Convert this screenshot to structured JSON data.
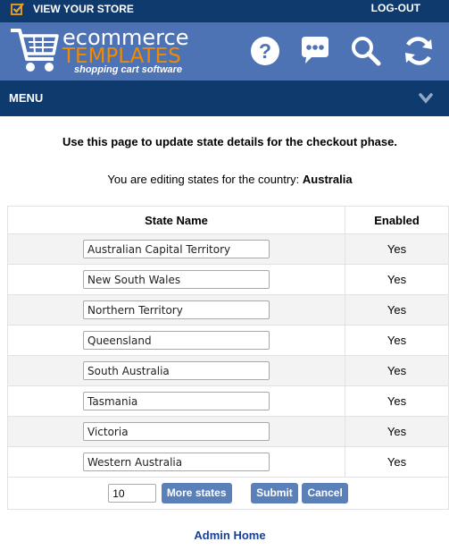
{
  "topbar": {
    "view_store": "VIEW YOUR STORE",
    "logout": "LOG-OUT"
  },
  "logo": {
    "line1": "ecommerce",
    "line2": "TEMPLATES",
    "tagline": "shopping cart software"
  },
  "header_icons": [
    "help-icon",
    "chat-icon",
    "search-icon",
    "refresh-icon"
  ],
  "menu": {
    "label": "MENU"
  },
  "intro": "Use this page to update state details for the checkout phase.",
  "country_prefix": "You are editing states for the country: ",
  "country": "Australia",
  "table": {
    "headers": [
      "State Name",
      "Enabled"
    ],
    "rows": [
      {
        "state": "Australian Capital Territory",
        "enabled": "Yes"
      },
      {
        "state": "New South Wales",
        "enabled": "Yes"
      },
      {
        "state": "Northern Territory",
        "enabled": "Yes"
      },
      {
        "state": "Queensland",
        "enabled": "Yes"
      },
      {
        "state": "South Australia",
        "enabled": "Yes"
      },
      {
        "state": "Tasmania",
        "enabled": "Yes"
      },
      {
        "state": "Victoria",
        "enabled": "Yes"
      },
      {
        "state": "Western Australia",
        "enabled": "Yes"
      }
    ]
  },
  "footer": {
    "count_value": "10",
    "more_states": "More states",
    "submit": "Submit",
    "cancel": "Cancel"
  },
  "admin_home": "Admin Home",
  "colors": {
    "nav_dark": "#0e3a6e",
    "header_blue": "#4e73b5",
    "logo_orange": "#f08a00",
    "button": "#5b7fb8",
    "link": "#1a3f94"
  }
}
